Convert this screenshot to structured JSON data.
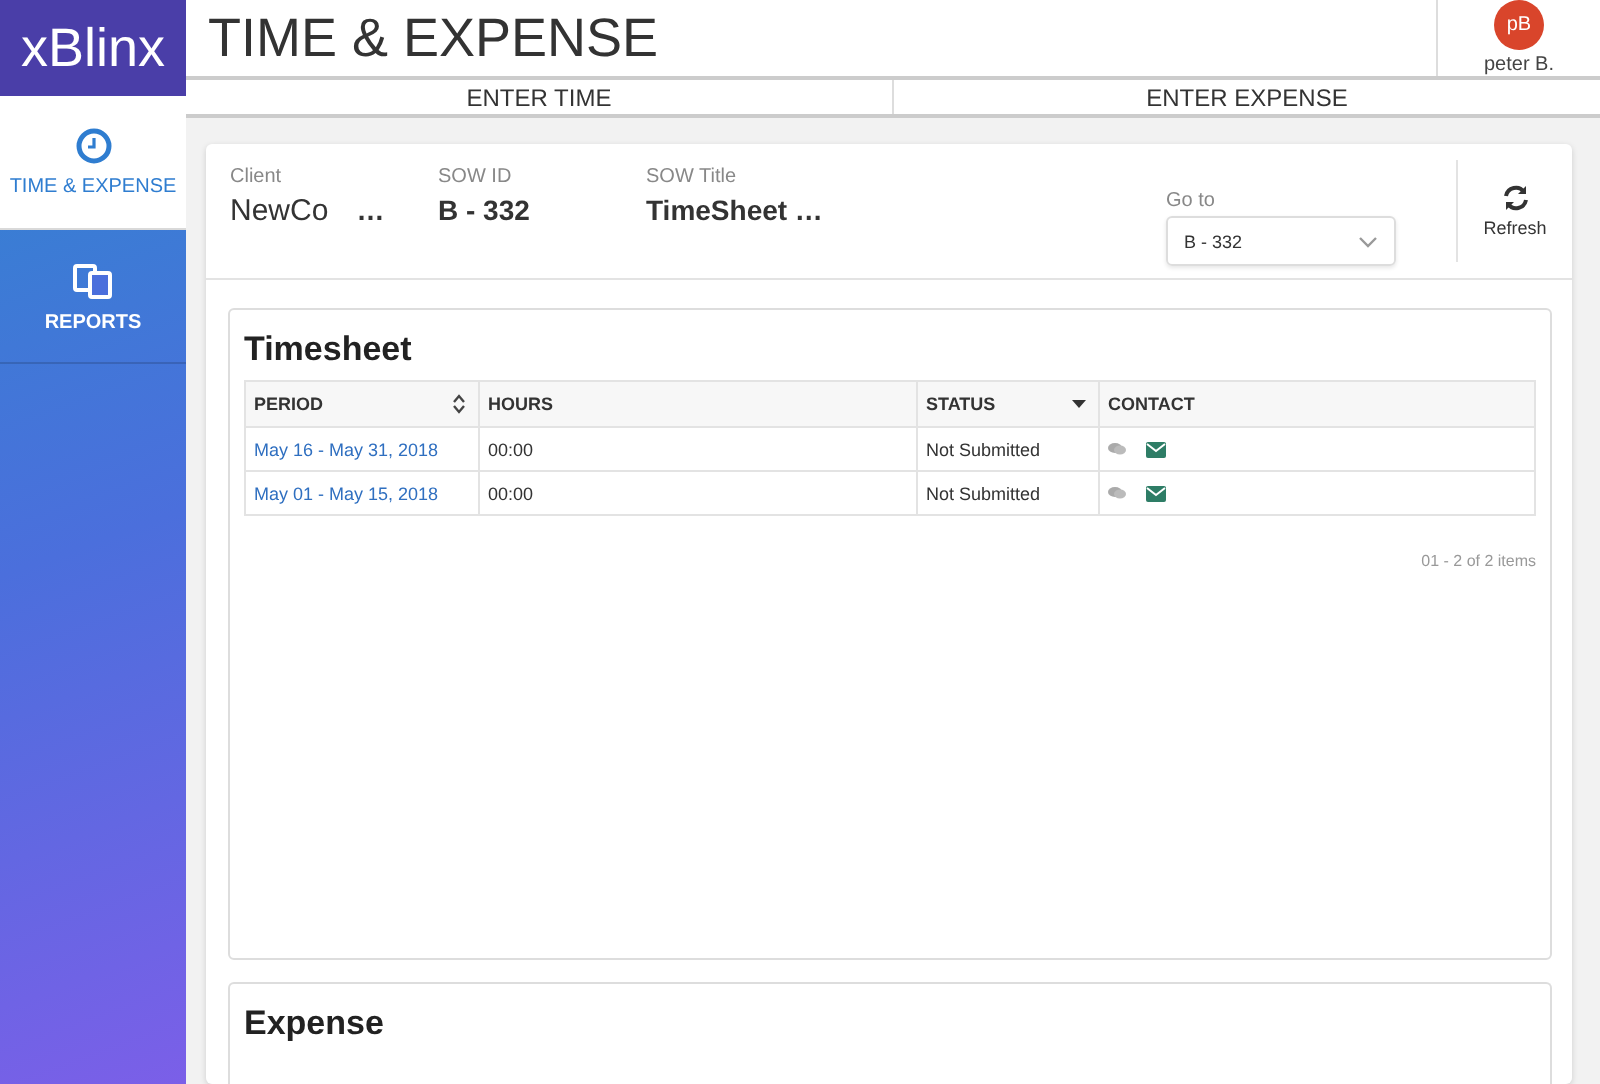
{
  "logo": "xBlinx",
  "title": "TIME & EXPENSE",
  "user": {
    "initials": "pB",
    "name": "peter B."
  },
  "sidebar": {
    "items": [
      {
        "label": "TIME & EXPENSE",
        "kind": "clock",
        "selected": true
      },
      {
        "label": "REPORTS",
        "kind": "copy",
        "selected": false
      }
    ]
  },
  "tabs": [
    {
      "label": "ENTER TIME"
    },
    {
      "label": "ENTER EXPENSE"
    }
  ],
  "info": {
    "fields": [
      {
        "label": "Client",
        "value": "NewCo",
        "extra": "…"
      },
      {
        "label": "SOW ID",
        "value": "B - 332"
      },
      {
        "label": "SOW Title",
        "value": "TimeSheet …"
      }
    ],
    "goto": {
      "label": "Go to",
      "value": "B - 332"
    },
    "refresh": "Refresh"
  },
  "timesheet": {
    "title": "Timesheet",
    "columns": [
      {
        "label": "PERIOD",
        "kind": "sortable"
      },
      {
        "label": "HOURS",
        "kind": "plain"
      },
      {
        "label": "STATUS",
        "kind": "filter"
      },
      {
        "label": "CONTACT",
        "kind": "plain"
      }
    ],
    "rows": [
      {
        "period": "May 16 - May 31, 2018",
        "hours": "00:00",
        "status": "Not Submitted"
      },
      {
        "period": "May 01 - May 15, 2018",
        "hours": "00:00",
        "status": "Not Submitted"
      }
    ],
    "pager": "01 - 2 of 2 items"
  },
  "expense": {
    "title": "Expense"
  }
}
